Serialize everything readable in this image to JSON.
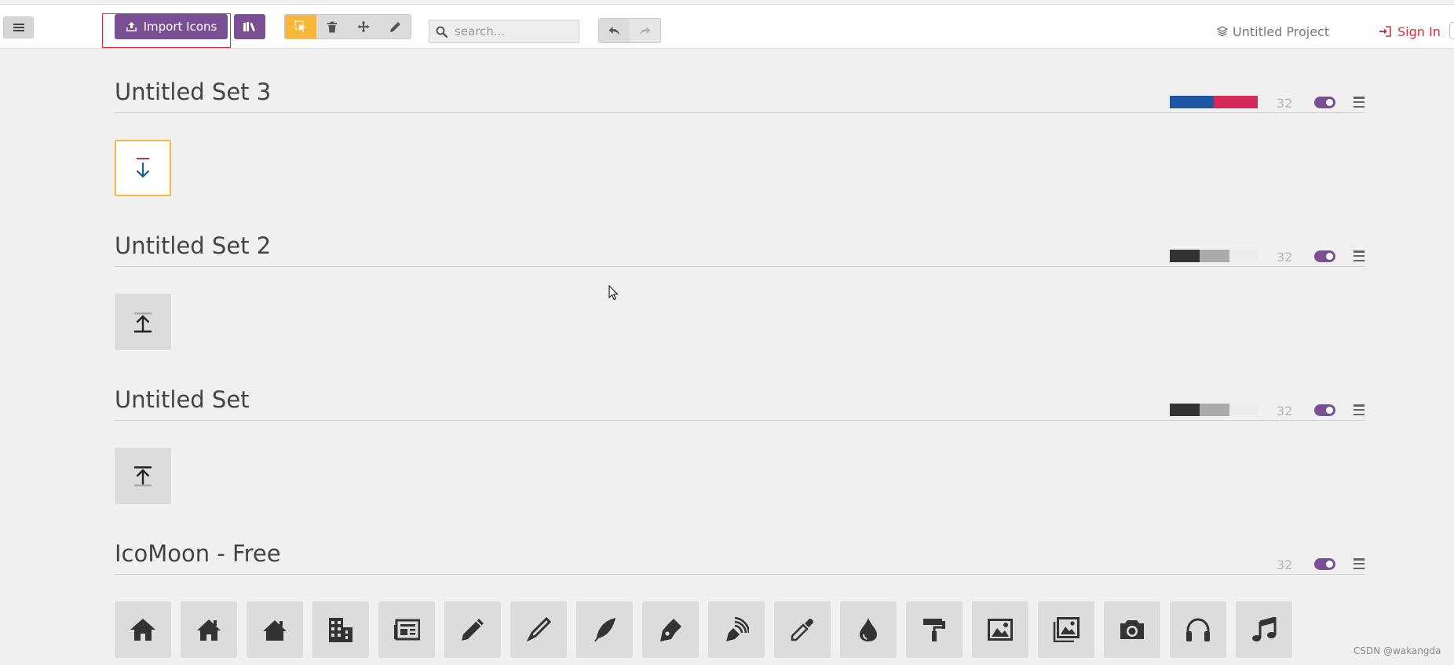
{
  "toolbar": {
    "import_label": "Import Icons",
    "search_placeholder": "search...",
    "project_name": "Untitled Project",
    "signin_label": "Sign In",
    "accent_color": "#7b4f94",
    "active_tool_color": "#f6b73c",
    "signin_color": "#d3323a"
  },
  "sets": [
    {
      "title": "Untitled Set 3",
      "count": "32",
      "colors": [
        "#1e57a3",
        "#d42a57"
      ],
      "icons": [
        "arrow-down-icon"
      ],
      "selected_index": 0
    },
    {
      "title": "Untitled Set 2",
      "count": "32",
      "colors": [
        "#333333",
        "#aaaaaa",
        "#f0f0f0"
      ],
      "icons": [
        "upload-icon"
      ]
    },
    {
      "title": "Untitled Set",
      "count": "32",
      "colors": [
        "#333333",
        "#aaaaaa",
        "#f0f0f0"
      ],
      "icons": [
        "upload-icon"
      ]
    },
    {
      "title": "IcoMoon - Free",
      "count": "32",
      "colors": [],
      "icons": [
        "home-icon",
        "home2-icon",
        "home3-icon",
        "office-icon",
        "newspaper-icon",
        "pencil-icon",
        "pencil2-icon",
        "quill-icon",
        "pen-icon",
        "blog-icon",
        "eyedropper-icon",
        "droplet-icon",
        "paint-format-icon",
        "image-icon",
        "images-icon",
        "camera-icon",
        "headphones-icon",
        "music-icon"
      ]
    }
  ],
  "watermark": "CSDN @wakangda"
}
